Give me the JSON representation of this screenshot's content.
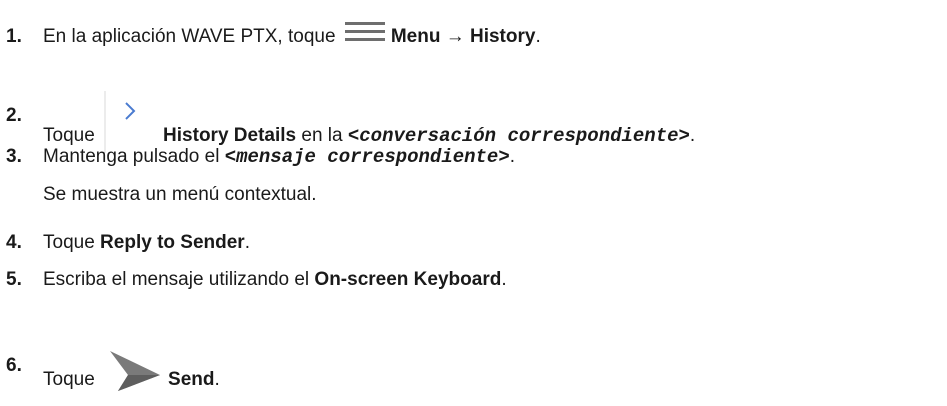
{
  "steps": [
    {
      "number": "1.",
      "pre": "En la aplicación WAVE PTX, toque ",
      "icon": "hamburger-menu-icon",
      "bold1": "Menu",
      "arrow": " → ",
      "bold2": "History",
      "post": "."
    },
    {
      "number": "2.",
      "pre": "Toque ",
      "icon": "chevron-right-icon",
      "bold": "History Details",
      "mid": " en la ",
      "mono": "<conversación correspondiente>",
      "post": "."
    },
    {
      "number": "3.",
      "pre": "Mantenga pulsado el ",
      "mono": "<mensaje correspondiente>",
      "post": ".",
      "result": "Se muestra un menú contextual."
    },
    {
      "number": "4.",
      "pre": "Toque ",
      "bold": "Reply to Sender",
      "post": "."
    },
    {
      "number": "5.",
      "pre": "Escriba el mensaje utilizando el ",
      "bold": "On-screen Keyboard",
      "post": "."
    },
    {
      "number": "6.",
      "pre": "Toque ",
      "icon": "send-arrow-icon",
      "bold": "Send",
      "post": "."
    }
  ],
  "colors": {
    "text": "#1a1a1a",
    "icon_gray": "#7a7a7a",
    "chevron_blue": "#4a7bd0",
    "divider": "#d8d8d8"
  }
}
